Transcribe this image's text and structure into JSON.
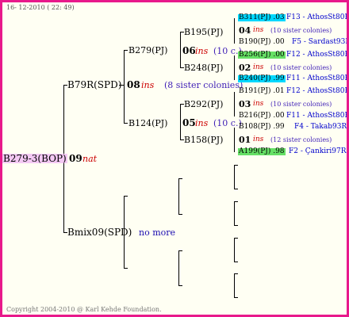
{
  "header": {
    "date_line": "16- 12-2010 ( 22: 49)"
  },
  "footer": {
    "copyright": "Copyright 2004-2010 @ Karl Kehde Foundation."
  },
  "colors": {
    "frame_border": "#e8198b",
    "root_bg": "#f4c9f4",
    "blue_bg": "#00d8ff",
    "green_bg": "#66e066",
    "note": "#3f1fb6",
    "ins": "#cc0000"
  },
  "root": {
    "label": "B279-3(BOP)",
    "gen": "09",
    "mark": "nat"
  },
  "gen1": {
    "top": {
      "label": "B79R(SPD)",
      "gen": "08",
      "mark": "ins",
      "note": "(8 sister colonies)"
    },
    "bottom": {
      "label": "Bmix09(SPD)",
      "note": "no more"
    }
  },
  "gen2": {
    "a": {
      "label": "B279(PJ)"
    },
    "b": {
      "label": "B124(PJ)"
    }
  },
  "gen3": {
    "a": {
      "label": "B195(PJ)",
      "gen": "06",
      "mark": "ins",
      "note": "(10 c.)"
    },
    "b": {
      "label": "B248(PJ)"
    },
    "c": {
      "label": "B292(PJ)",
      "gen": "05",
      "mark": "ins",
      "note": "(10 c.)"
    },
    "d": {
      "label": "B158(PJ)"
    }
  },
  "gen4": [
    {
      "label": "B311(PJ) .03",
      "info": "F13 - AthosSt80R"
    },
    {
      "gen": "04",
      "mark": "ins",
      "note": "(10 sister colonies)"
    },
    {
      "label": "B190(PJ) .00",
      "info": "F5 - Sardast93R"
    },
    {
      "label": "B256(PJ) .00",
      "info": "F12 - AthosSt80R"
    },
    {
      "gen": "02",
      "mark": "ins",
      "note": "(10 sister colonies)"
    },
    {
      "label": "B240(PJ) .99",
      "info": "F11 - AthosSt80R"
    },
    {
      "label": "B191(PJ) .01",
      "info": "F12 - AthosSt80R"
    },
    {
      "gen": "03",
      "mark": "ins",
      "note": "(10 sister colonies)"
    },
    {
      "label": "B216(PJ) .00",
      "info": "F11 - AthosSt80R"
    },
    {
      "label": "B108(PJ) .99",
      "info": "F4 - Takab93R"
    },
    {
      "gen": "01",
      "mark": "ins",
      "note": "(12 sister colonies)"
    },
    {
      "label": "A199(PJ) .98",
      "info": "F2 - Çankiri97R"
    }
  ]
}
